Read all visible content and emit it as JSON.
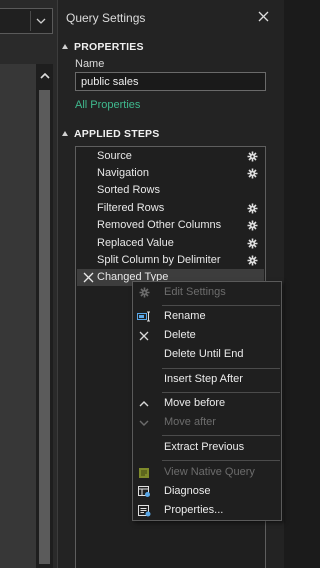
{
  "panel": {
    "title": "Query Settings"
  },
  "properties": {
    "heading": "PROPERTIES",
    "name_label": "Name",
    "name_value": "public sales",
    "all_properties_link": "All Properties"
  },
  "applied_steps": {
    "heading": "APPLIED STEPS",
    "steps": [
      {
        "label": "Source",
        "has_settings": true
      },
      {
        "label": "Navigation",
        "has_settings": true
      },
      {
        "label": "Sorted Rows",
        "has_settings": false
      },
      {
        "label": "Filtered Rows",
        "has_settings": true
      },
      {
        "label": "Removed Other Columns",
        "has_settings": true
      },
      {
        "label": "Replaced Value",
        "has_settings": true
      },
      {
        "label": "Split Column by Delimiter",
        "has_settings": true
      },
      {
        "label": "Changed Type",
        "has_settings": false,
        "selected": true
      }
    ]
  },
  "context_menu": {
    "items": [
      {
        "label": "Edit Settings",
        "icon": "gear-icon",
        "enabled": false
      },
      {
        "label": "Rename",
        "icon": "rename-icon",
        "enabled": true
      },
      {
        "label": "Delete",
        "icon": "delete-icon",
        "enabled": true
      },
      {
        "label": "Delete Until End",
        "icon": "",
        "enabled": true
      },
      {
        "label": "Insert Step After",
        "icon": "",
        "enabled": true
      },
      {
        "label": "Move before",
        "icon": "chevron-up-icon",
        "enabled": true
      },
      {
        "label": "Move after",
        "icon": "chevron-down-icon",
        "enabled": false
      },
      {
        "label": "Extract Previous",
        "icon": "",
        "enabled": true
      },
      {
        "label": "View Native Query",
        "icon": "native-query-icon",
        "enabled": false,
        "highlighted": true
      },
      {
        "label": "Diagnose",
        "icon": "diagnose-icon",
        "enabled": true
      },
      {
        "label": "Properties...",
        "icon": "properties-icon",
        "enabled": true
      }
    ]
  },
  "colors": {
    "link": "#3fb98e",
    "highlight": "#3d4412",
    "background": "#232323"
  }
}
